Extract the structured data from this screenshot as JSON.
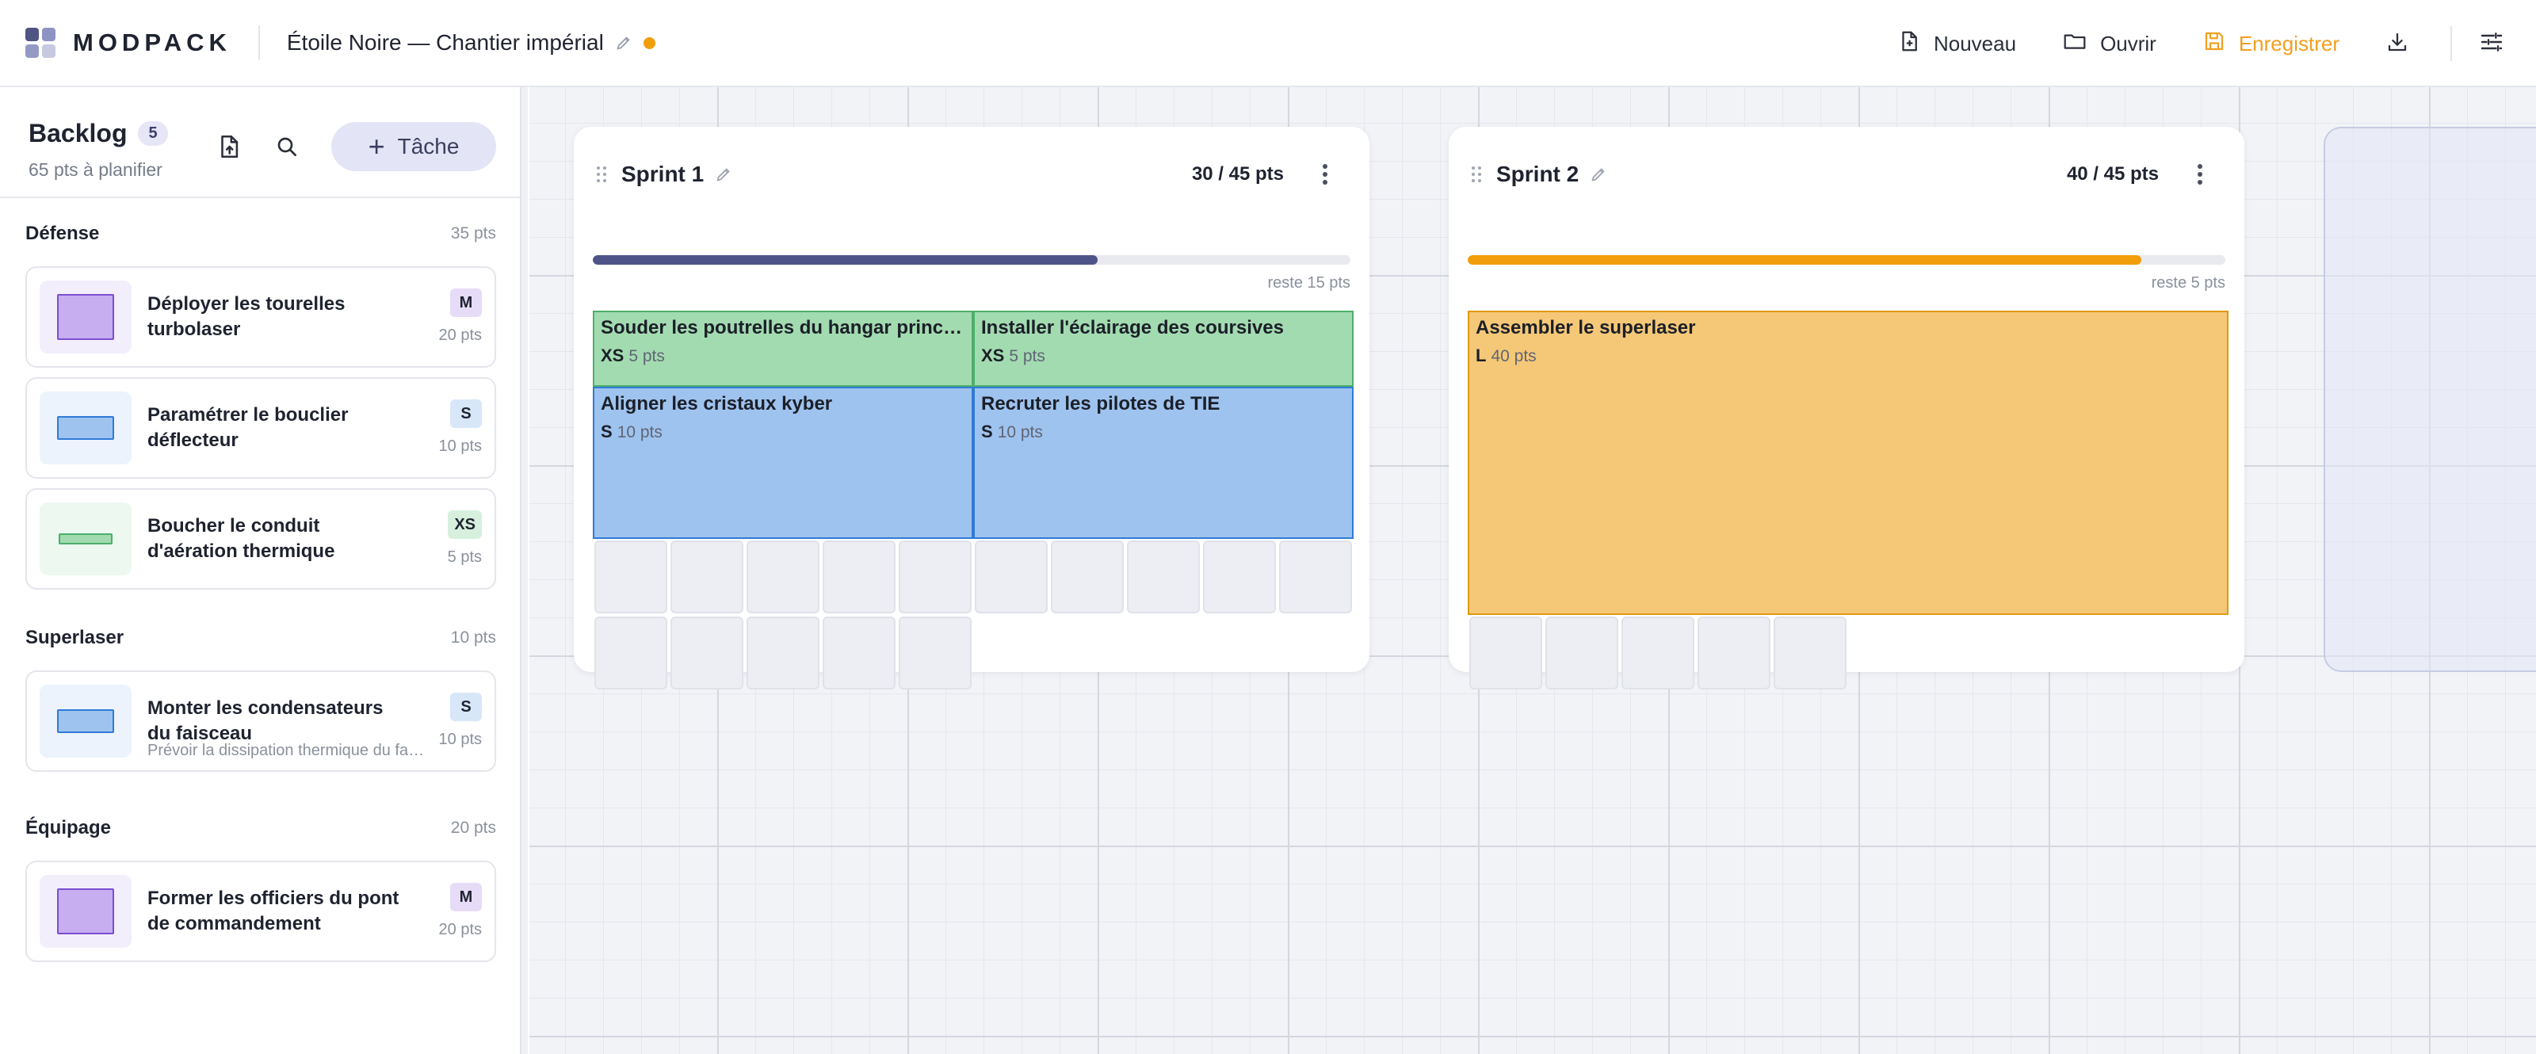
{
  "app": {
    "name": "MODPACK",
    "logo_colors": [
      "#4f5482",
      "#8e93c2",
      "#9499c4",
      "#c6c9e0"
    ]
  },
  "project": {
    "title": "Étoile Noire — Chantier impérial",
    "unsaved_dot_color": "#f29d0b"
  },
  "toolbar": {
    "new_label": "Nouveau",
    "open_label": "Ouvrir",
    "save_label": "Enregistrer",
    "save_color": "#f0a020",
    "icons": [
      "file-plus-icon",
      "folder-icon",
      "save-icon",
      "download-icon",
      "sliders-icon"
    ]
  },
  "sidebar": {
    "title": "Backlog",
    "count": "5",
    "subtitle": "65 pts à planifier",
    "add_task_label": "Tâche",
    "groups": [
      {
        "name": "Défense",
        "points": "35 pts",
        "tasks": [
          {
            "name": "Déployer les tourelles turbolaser",
            "size": "M",
            "points": "20 pts",
            "description": ""
          },
          {
            "name": "Paramétrer le bouclier déflecteur",
            "size": "S",
            "points": "10 pts",
            "description": ""
          },
          {
            "name": "Boucher le conduit d'aération thermique",
            "size": "XS",
            "points": "5 pts",
            "description": ""
          }
        ]
      },
      {
        "name": "Superlaser",
        "points": "10 pts",
        "tasks": [
          {
            "name": "Monter les condensateurs du faisceau",
            "size": "S",
            "points": "10 pts",
            "description": "Prévoir la dissipation thermique du faisceau principal"
          }
        ]
      },
      {
        "name": "Équipage",
        "points": "20 pts",
        "tasks": [
          {
            "name": "Former les officiers du pont de commandement",
            "size": "M",
            "points": "20 pts",
            "description": ""
          }
        ]
      }
    ]
  },
  "size_styles": {
    "XS": {
      "fill": "#a3dbb1",
      "border": "#4caf6a",
      "tint": "#edf8f0",
      "badge": "#d6f0dd"
    },
    "S": {
      "fill": "#9fc3ef",
      "border": "#2f7ad6",
      "tint": "#ecf3fc",
      "badge": "#d8e7f8"
    },
    "M": {
      "fill": "#c7aef0",
      "border": "#7a4fd0",
      "tint": "#f3eefc",
      "badge": "#e6dcf8"
    },
    "L": {
      "fill": "#f5c878",
      "border": "#e09a10",
      "tint": "#fdf4e2",
      "badge": "#fbe6bd"
    }
  },
  "sprints": [
    {
      "name": "Sprint 1",
      "capacity_text": "30 / 45 pts",
      "progress": 0.6667,
      "bar_color": "#4f5488",
      "remaining": "reste 15 pts",
      "placed": [
        {
          "name": "Souder les poutrelles du hangar principal",
          "size": "XS",
          "points": "5 pts"
        },
        {
          "name": "Installer l'éclairage des coursives",
          "size": "XS",
          "points": "5 pts"
        },
        {
          "name": "Aligner les cristaux kyber",
          "size": "S",
          "points": "10 pts"
        },
        {
          "name": "Recruter les pilotes de TIE",
          "size": "S",
          "points": "10 pts"
        }
      ],
      "empty_slots": 15
    },
    {
      "name": "Sprint 2",
      "capacity_text": "40 / 45 pts",
      "progress": 0.8889,
      "bar_color": "#f29d0b",
      "remaining": "reste 5 pts",
      "placed": [
        {
          "name": "Assembler le superlaser",
          "size": "L",
          "points": "40 pts"
        }
      ],
      "empty_slots": 5
    }
  ]
}
